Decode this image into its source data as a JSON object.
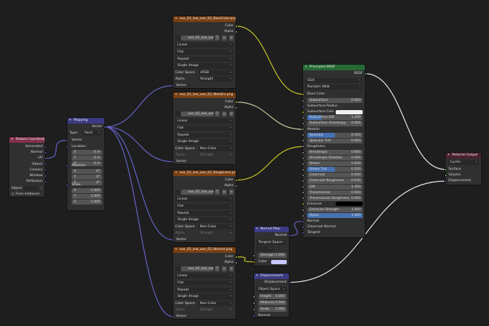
{
  "texcoord": {
    "title": "Texture Coordinate",
    "outputs": [
      "Generated",
      "Normal",
      "UV",
      "Object",
      "Camera",
      "Window",
      "Reflection"
    ],
    "object_label": "Object",
    "from_instancer": "From Instancer"
  },
  "mapping": {
    "title": "Mapping",
    "output": "Vector",
    "type_label": "Type:",
    "type_value": "Point",
    "vector_label": "Vector",
    "location_label": "Location:",
    "rotation_label": "Rotation:",
    "scale_label": "Scale:",
    "location": [
      {
        "axis": "X",
        "value": "0 m"
      },
      {
        "axis": "Y",
        "value": "0 m"
      },
      {
        "axis": "Z",
        "value": "0 m"
      }
    ],
    "rotation": [
      {
        "axis": "X",
        "value": "0°"
      },
      {
        "axis": "Y",
        "value": "0°"
      },
      {
        "axis": "Z",
        "value": "0°"
      }
    ],
    "scale": [
      {
        "axis": "X",
        "value": "1.000"
      },
      {
        "axis": "Y",
        "value": "1.000"
      },
      {
        "axis": "Z",
        "value": "1.000"
      }
    ]
  },
  "textures": [
    {
      "title": "axe_02_low_axe_02_BaseColor.png",
      "image": "axe_02_low_axe_0...",
      "interp": "Linear",
      "proj": "Flat",
      "ext": "Repeat",
      "source": "Single Image",
      "cs_label": "Color Space",
      "cs": "sRGB",
      "alpha_label": "Alpha",
      "alpha": "Straight",
      "out_color": "Color",
      "out_alpha": "Alpha",
      "in_vector": "Vector"
    },
    {
      "title": "axe_02_low_axe_02_Metallic.png",
      "image": "axe_02_low_axe_0...",
      "interp": "Linear",
      "proj": "Flat",
      "ext": "Repeat",
      "source": "Single Image",
      "cs_label": "Color Space",
      "cs": "Non-Color",
      "alpha_label": "Alpha",
      "alpha": "Straight",
      "out_color": "Color",
      "out_alpha": "Alpha",
      "in_vector": "Vector"
    },
    {
      "title": "axe_02_low_axe_02_Roughness.png",
      "image": "axe_02_low_axe_0...",
      "interp": "Linear",
      "proj": "Flat",
      "ext": "Repeat",
      "source": "Single Image",
      "cs_label": "Color Space",
      "cs": "Non-Color",
      "alpha_label": "Alpha",
      "alpha": "Straight",
      "out_color": "Color",
      "out_alpha": "Alpha",
      "in_vector": "Vector"
    },
    {
      "title": "axe_02_low_axe_02_Normal.png",
      "image": "axe_02_low_axe_0...",
      "interp": "Linear",
      "proj": "Flat",
      "ext": "Repeat",
      "source": "Single Image",
      "cs_label": "Color Space",
      "cs": "Non-Color",
      "alpha_label": "Alpha",
      "alpha": "Straight",
      "out_color": "Color",
      "out_alpha": "Alpha",
      "in_vector": "Vector"
    }
  ],
  "normalmap": {
    "title": "Normal Map",
    "output": "Normal",
    "space": "Tangent Space",
    "strength_label": "Strength",
    "strength": "1.000",
    "color_label": "Color",
    "color_swatch": "#c7c7ff"
  },
  "displacement": {
    "title": "Displacement",
    "output": "Displacement",
    "space": "Object Space",
    "height_label": "Height",
    "height": "0.000",
    "midlevel_label": "Midlevel",
    "midlevel": "0.500",
    "scale_label": "Scale",
    "scale": "1.000",
    "normal_label": "Normal"
  },
  "bsdf": {
    "title": "Principled BSDF",
    "output": "BSDF",
    "distribution": "GGX",
    "sss_method": "Random Walk",
    "base_color": "Base Color",
    "rows": [
      {
        "label": "Subsurface",
        "value": "0.000"
      },
      {
        "label": "Subsurface Radius",
        "value": ""
      },
      {
        "label": "Subsurface Colo",
        "value": ""
      },
      {
        "label": "Subsurface IOR",
        "value": "1.400"
      },
      {
        "label": "Subsurface Anisotropy",
        "value": "0.000"
      },
      {
        "label": "Metallic",
        "value": ""
      },
      {
        "label": "Specular",
        "value": "0.500"
      },
      {
        "label": "Specular Tint",
        "value": "0.000"
      },
      {
        "label": "Roughness",
        "value": ""
      },
      {
        "label": "Anisotropic",
        "value": "0.000"
      },
      {
        "label": "Anisotropic Rotation",
        "value": "0.000"
      },
      {
        "label": "Sheen",
        "value": "0.000"
      },
      {
        "label": "Sheen Tint",
        "value": "0.500"
      },
      {
        "label": "Clearcoat",
        "value": "0.000"
      },
      {
        "label": "Clearcoat Roughness",
        "value": "0.030"
      },
      {
        "label": "IOR",
        "value": "1.450"
      },
      {
        "label": "Transmission",
        "value": "0.000"
      },
      {
        "label": "Transmission Roughness",
        "value": "0.000"
      },
      {
        "label": "Emission",
        "value": ""
      },
      {
        "label": "Emission Strength",
        "value": "1.000"
      },
      {
        "label": "Alpha",
        "value": "1.000"
      },
      {
        "label": "Normal",
        "value": ""
      },
      {
        "label": "Clearcoat Normal",
        "value": ""
      },
      {
        "label": "Tangent",
        "value": ""
      }
    ]
  },
  "output": {
    "title": "Material Output",
    "target": "Cycles",
    "inputs": [
      "Surface",
      "Volume",
      "Displacement"
    ]
  },
  "colors": {
    "accent": "#4772b3",
    "texture_header": "#7a3f11",
    "vector_header": "#3b3b83",
    "input_header": "#83314a",
    "shader_header": "#266a36",
    "output_header": "#4b2131",
    "color_socket": "#c7c729",
    "float_socket": "#a1a1a1",
    "vector_socket": "#6363c7",
    "shader_socket": "#63c763"
  }
}
